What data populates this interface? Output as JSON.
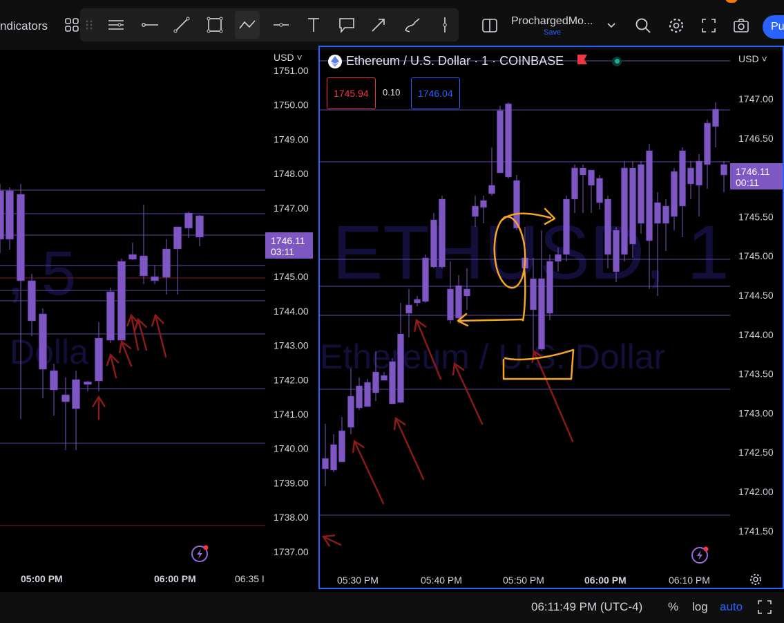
{
  "toolbar": {
    "indicators_label": "ndicators",
    "layout_name": "ProchargedMo...",
    "layout_save": "Save",
    "publish_label": "Pu"
  },
  "left_chart": {
    "currency": "USD",
    "watermark_big": ", 5",
    "watermark_small": "Dolla",
    "price_ticks": [
      "1751.00",
      "1750.00",
      "1749.00",
      "1748.00",
      "1747.00",
      "1746.00",
      "1745.00",
      "1744.00",
      "1743.00",
      "1742.00",
      "1741.00",
      "1740.00",
      "1739.00",
      "1738.00",
      "1737.00"
    ],
    "time_ticks": [
      "05:00 PM",
      "06:00 PM",
      "06:35 I"
    ],
    "last_price": "1746.11",
    "countdown": "03:11"
  },
  "right_chart": {
    "symbol_title": "Ethereum / U.S. Dollar · 1 · COINBASE",
    "bid": "1745.94",
    "spread": "0.10",
    "ask": "1746.04",
    "currency": "USD",
    "watermark_big": "ETHUSD, 1",
    "watermark_small": "Ethereum / U.S. Dollar",
    "price_ticks": [
      "1747.00",
      "1746.50",
      "1746.00",
      "1745.50",
      "1745.00",
      "1744.50",
      "1744.00",
      "1743.50",
      "1743.00",
      "1742.50",
      "1742.00",
      "1741.50"
    ],
    "time_ticks": [
      "05:30 PM",
      "05:40 PM",
      "05:50 PM",
      "06:00 PM",
      "06:10 PM"
    ],
    "last_price": "1746.11",
    "countdown": "00:11"
  },
  "statusbar": {
    "clock": "06:11:49 PM (UTC-4)",
    "percent": "%",
    "log": "log",
    "auto": "auto"
  },
  "colors": {
    "candle": "#7e57c2",
    "accent": "#2962ff",
    "bid": "#f23645",
    "arrow": "#8b1a1a",
    "annotation": "#f5a623"
  }
}
